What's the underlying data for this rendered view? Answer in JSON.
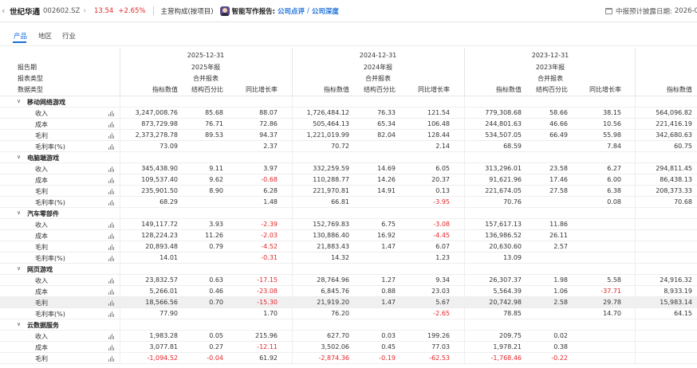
{
  "header": {
    "back_icon": "chevron-left-icon",
    "stock_name": "世纪华通",
    "stock_code": "002602.SZ",
    "forward_icon": "chevron-right-icon",
    "price": "13.54",
    "change_pct": "+2.65%",
    "category": "主营构成(按项目)",
    "ai_label": "智能写作报告:",
    "link_review": "公司点评",
    "link_sep": "/",
    "link_deep": "公司深度",
    "disclosure_label": "中报预计披露日期:",
    "disclosure_date": "2026-0",
    "up_color": "#e3262a",
    "link_color": "#1a6fd6"
  },
  "tabs": [
    "产品",
    "地区",
    "行业"
  ],
  "active_tab": "产品",
  "table_header": {
    "row_labels": [
      "报告期",
      "报表类型",
      "数据类型"
    ],
    "periods": [
      {
        "date": "2025-12-31",
        "report": "2025年报",
        "type": "合并报表"
      },
      {
        "date": "2024-12-31",
        "report": "2024年报",
        "type": "合并报表"
      },
      {
        "date": "2023-12-31",
        "report": "2023年报",
        "type": "合并报表"
      }
    ],
    "columns": [
      "指标数值",
      "结构百分比",
      "同比增长率"
    ],
    "trailing_column": "指标数值"
  },
  "groups": [
    {
      "name": "移动网络游戏",
      "rows": [
        {
          "label": "收入",
          "values": [
            "3,247,008.76",
            "85.68",
            "88.07",
            "1,726,484.12",
            "76.33",
            "121.54",
            "779,308.68",
            "58.66",
            "38.15",
            "564,096.82"
          ]
        },
        {
          "label": "成本",
          "values": [
            "873,729.98",
            "76.71",
            "72.86",
            "505,464.13",
            "65.34",
            "106.48",
            "244,801.63",
            "46.66",
            "10.56",
            "221,416.19"
          ]
        },
        {
          "label": "毛利",
          "values": [
            "2,373,278.78",
            "89.53",
            "94.37",
            "1,221,019.99",
            "82.04",
            "128.44",
            "534,507.05",
            "66.49",
            "55.98",
            "342,680.63"
          ]
        },
        {
          "label": "毛利率(%)",
          "values": [
            "73.09",
            "",
            "2.37",
            "70.72",
            "",
            "2.14",
            "68.59",
            "",
            "7.84",
            "60.75"
          ]
        }
      ]
    },
    {
      "name": "电脑端游戏",
      "rows": [
        {
          "label": "收入",
          "values": [
            "345,438.90",
            "9.11",
            "3.97",
            "332,259.59",
            "14.69",
            "6.05",
            "313,296.01",
            "23.58",
            "6.27",
            "294,811.45"
          ]
        },
        {
          "label": "成本",
          "values": [
            "109,537.40",
            "9.62",
            "-0.68",
            "110,288.77",
            "14.26",
            "20.37",
            "91,621.96",
            "17.46",
            "6.00",
            "86,438.13"
          ]
        },
        {
          "label": "毛利",
          "values": [
            "235,901.50",
            "8.90",
            "6.28",
            "221,970.81",
            "14.91",
            "0.13",
            "221,674.05",
            "27.58",
            "6.38",
            "208,373.33"
          ]
        },
        {
          "label": "毛利率(%)",
          "values": [
            "68.29",
            "",
            "1.48",
            "66.81",
            "",
            "-3.95",
            "70.76",
            "",
            "0.08",
            "70.68"
          ]
        }
      ]
    },
    {
      "name": "汽车零部件",
      "rows": [
        {
          "label": "收入",
          "values": [
            "149,117.72",
            "3.93",
            "-2.39",
            "152,769.83",
            "6.75",
            "-3.08",
            "157,617.13",
            "11.86",
            "",
            ""
          ]
        },
        {
          "label": "成本",
          "values": [
            "128,224.23",
            "11.26",
            "-2.03",
            "130,886.40",
            "16.92",
            "-4.45",
            "136,986.52",
            "26.11",
            "",
            ""
          ]
        },
        {
          "label": "毛利",
          "values": [
            "20,893.48",
            "0.79",
            "-4.52",
            "21,883.43",
            "1.47",
            "6.07",
            "20,630.60",
            "2.57",
            "",
            ""
          ]
        },
        {
          "label": "毛利率(%)",
          "values": [
            "14.01",
            "",
            "-0.31",
            "14.32",
            "",
            "1.23",
            "13.09",
            "",
            "",
            ""
          ]
        }
      ]
    },
    {
      "name": "网页游戏",
      "rows": [
        {
          "label": "收入",
          "values": [
            "23,832.57",
            "0.63",
            "-17.15",
            "28,764.96",
            "1.27",
            "9.34",
            "26,307.37",
            "1.98",
            "5.58",
            "24,916.32"
          ]
        },
        {
          "label": "成本",
          "values": [
            "5,266.01",
            "0.46",
            "-23.08",
            "6,845.76",
            "0.88",
            "23.03",
            "5,564.39",
            "1.06",
            "-37.71",
            "8,933.19"
          ]
        },
        {
          "label": "毛利",
          "values": [
            "18,566.56",
            "0.70",
            "-15.30",
            "21,919.20",
            "1.47",
            "5.67",
            "20,742.98",
            "2.58",
            "29.78",
            "15,983.14"
          ]
        },
        {
          "label": "毛利率(%)",
          "values": [
            "77.90",
            "",
            "1.70",
            "76.20",
            "",
            "-2.65",
            "78.85",
            "",
            "14.70",
            "64.15"
          ]
        }
      ]
    },
    {
      "name": "云数据服务",
      "rows": [
        {
          "label": "收入",
          "values": [
            "1,983.28",
            "0.05",
            "215.96",
            "627.70",
            "0.03",
            "199.26",
            "209.75",
            "0.02",
            "",
            ""
          ]
        },
        {
          "label": "成本",
          "values": [
            "3,077.81",
            "0.27",
            "-12.11",
            "3,502.06",
            "0.45",
            "77.03",
            "1,978.21",
            "0.38",
            "",
            ""
          ]
        },
        {
          "label": "毛利",
          "values": [
            "-1,094.52",
            "-0.04",
            "61.92",
            "-2,874.36",
            "-0.19",
            "-62.53",
            "-1,768.46",
            "-0.22",
            "",
            ""
          ]
        }
      ]
    }
  ]
}
